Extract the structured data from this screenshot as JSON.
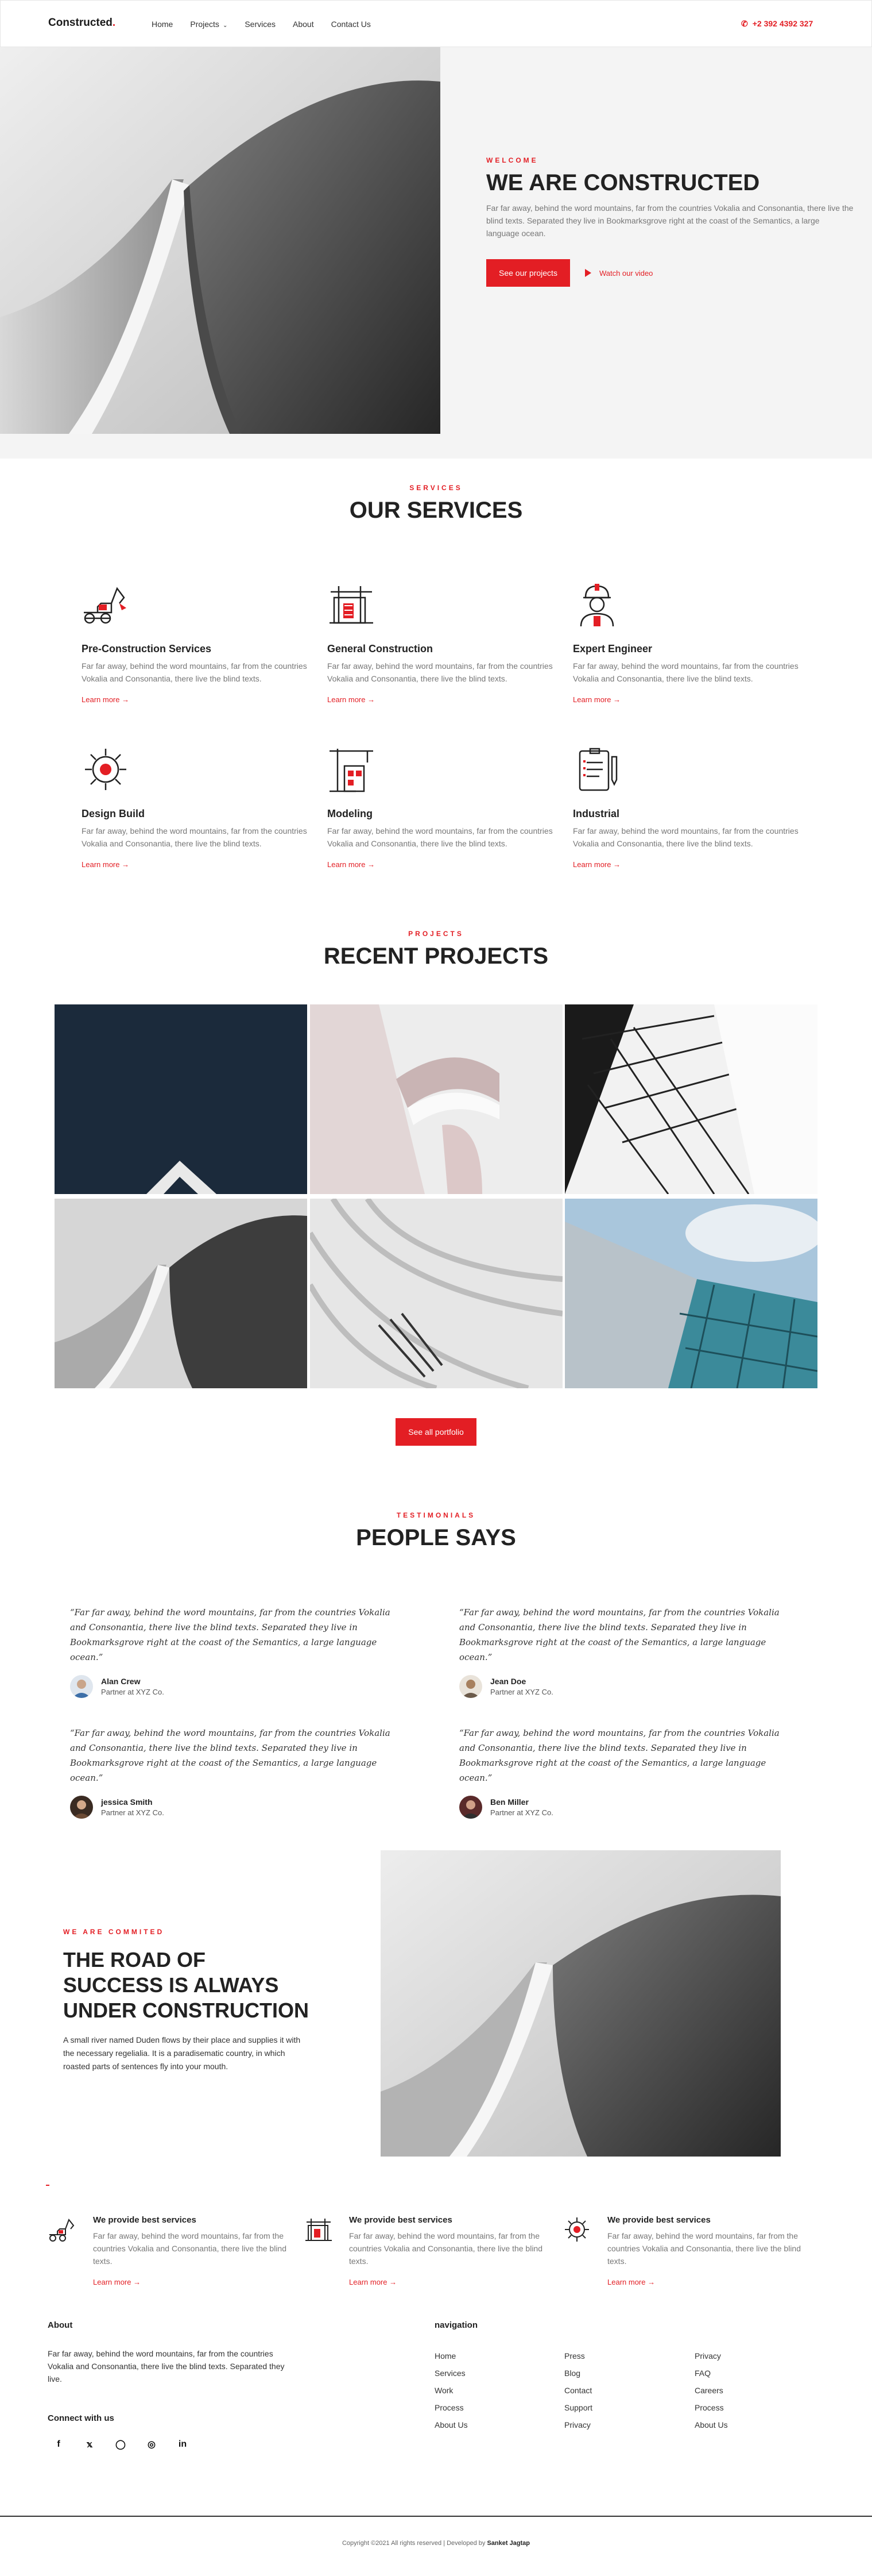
{
  "nav": {
    "brand": "Constructed",
    "brand_dot": ".",
    "items": [
      "Home",
      "Projects",
      "Services",
      "About",
      "Contact Us"
    ],
    "phone": "+2 392 4392 327"
  },
  "hero": {
    "eyebrow": "WELCOME",
    "title": "WE ARE CONSTRUCTED",
    "text": "Far far away, behind the word mountains, far from the countries Vokalia and Consonantia, there live the blind texts. Separated they live in Bookmarksgrove right at the coast of the Semantics, a large language ocean.",
    "primary_button": "See our projects",
    "video_link": "Watch our video"
  },
  "services": {
    "eyebrow": "SERVICES",
    "title": "OUR SERVICES",
    "items": [
      {
        "title": "Pre-Construction Services",
        "text": "Far far away, behind the word mountains, far from the countries Vokalia and Consonantia, there live the blind texts.",
        "link": "Learn more",
        "icon": "excavator-icon"
      },
      {
        "title": "General Construction",
        "text": "Far far away, behind the word mountains, far from the countries Vokalia and Consonantia, there live the blind texts.",
        "link": "Learn more",
        "icon": "crane-building-icon"
      },
      {
        "title": "Expert Engineer",
        "text": "Far far away, behind the word mountains, far from the countries Vokalia and Consonantia, there live the blind texts.",
        "link": "Learn more",
        "icon": "engineer-icon"
      },
      {
        "title": "Design Build",
        "text": "Far far away, behind the word mountains, far from the countries Vokalia and Consonantia, there live the blind texts.",
        "link": "Learn more",
        "icon": "gear-icon"
      },
      {
        "title": "Modeling",
        "text": "Far far away, behind the word mountains, far from the countries Vokalia and Consonantia, there live the blind texts.",
        "link": "Learn more",
        "icon": "tower-crane-icon"
      },
      {
        "title": "Industrial",
        "text": "Far far away, behind the word mountains, far from the countries Vokalia and Consonantia, there live the blind texts.",
        "link": "Learn more",
        "icon": "clipboard-icon"
      }
    ]
  },
  "projects": {
    "eyebrow": "PROJECTS",
    "title": "RECENT PROJECTS",
    "button": "See all portfolio"
  },
  "testimonials": {
    "eyebrow": "TESTIMONIALS",
    "title": "PEOPLE SAYS",
    "items": [
      {
        "quote": "“Far far away, behind the word mountains, far from the countries Vokalia and Consonantia, there live the blind texts. Separated they live in Bookmarksgrove right at the coast of the Semantics, a large language ocean.”",
        "name": "Alan Crew",
        "role": "Partner at XYZ Co."
      },
      {
        "quote": "“Far far away, behind the word mountains, far from the countries Vokalia and Consonantia, there live the blind texts. Separated they live in Bookmarksgrove right at the coast of the Semantics, a large language ocean.”",
        "name": "Jean Doe",
        "role": "Partner at XYZ Co."
      },
      {
        "quote": "“Far far away, behind the word mountains, far from the countries Vokalia and Consonantia, there live the blind texts. Separated they live in Bookmarksgrove right at the coast of the Semantics, a large language ocean.”",
        "name": "jessica Smith",
        "role": "Partner at XYZ Co."
      },
      {
        "quote": "“Far far away, behind the word mountains, far from the countries Vokalia and Consonantia, there live the blind texts. Separated they live in Bookmarksgrove right at the coast of the Semantics, a large language ocean.”",
        "name": "Ben Miller",
        "role": "Partner at XYZ Co."
      }
    ]
  },
  "road": {
    "eyebrow": "WE ARE COMMITED",
    "title": "THE ROAD OF SUCCESS IS ALWAYS UNDER CONSTRUCTION",
    "text": "A small river named Duden flows by their place and supplies it with the necessary regelialia. It is a paradisematic country, in which roasted parts of sentences fly into your mouth."
  },
  "best": {
    "items": [
      {
        "title": "We provide best services",
        "text": "Far far away, behind the word mountains, far from the countries Vokalia and Consonantia, there live the blind texts.",
        "link": "Learn more"
      },
      {
        "title": "We provide best services",
        "text": "Far far away, behind the word mountains, far from the countries Vokalia and Consonantia, there live the blind texts.",
        "link": "Learn more"
      },
      {
        "title": "We provide best services",
        "text": "Far far away, behind the word mountains, far from the countries Vokalia and Consonantia, there live the blind texts.",
        "link": "Learn more"
      }
    ]
  },
  "footer": {
    "about_title": "About",
    "about_text": "Far far away, behind the word mountains, far from the countries Vokalia and Consonantia, there live the blind texts. Separated they live.",
    "connect_title": "Connect with us",
    "nav_title": "navigation",
    "col1": [
      "Home",
      "Services",
      "Work",
      "Process",
      "About Us"
    ],
    "col2": [
      "Press",
      "Blog",
      "Contact",
      "Support",
      "Privacy"
    ],
    "col3": [
      "Privacy",
      "FAQ",
      "Careers",
      "Process",
      "About Us"
    ],
    "copyright": "Copyright ©2021 All rights reserved | Developed by ",
    "developer": "Sanket Jagtap"
  },
  "colors": {
    "accent": "#e31e24",
    "dark": "#222222"
  }
}
